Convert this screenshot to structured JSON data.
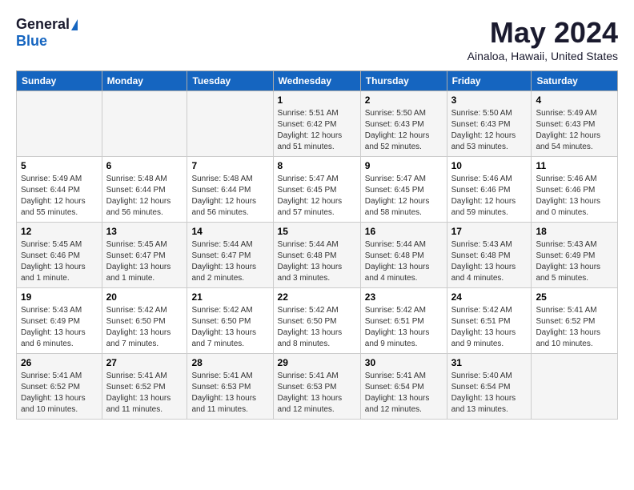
{
  "header": {
    "logo_general": "General",
    "logo_blue": "Blue",
    "month_title": "May 2024",
    "location": "Ainaloa, Hawaii, United States"
  },
  "days_of_week": [
    "Sunday",
    "Monday",
    "Tuesday",
    "Wednesday",
    "Thursday",
    "Friday",
    "Saturday"
  ],
  "weeks": [
    [
      {
        "day": "",
        "info": ""
      },
      {
        "day": "",
        "info": ""
      },
      {
        "day": "",
        "info": ""
      },
      {
        "day": "1",
        "info": "Sunrise: 5:51 AM\nSunset: 6:42 PM\nDaylight: 12 hours\nand 51 minutes."
      },
      {
        "day": "2",
        "info": "Sunrise: 5:50 AM\nSunset: 6:43 PM\nDaylight: 12 hours\nand 52 minutes."
      },
      {
        "day": "3",
        "info": "Sunrise: 5:50 AM\nSunset: 6:43 PM\nDaylight: 12 hours\nand 53 minutes."
      },
      {
        "day": "4",
        "info": "Sunrise: 5:49 AM\nSunset: 6:43 PM\nDaylight: 12 hours\nand 54 minutes."
      }
    ],
    [
      {
        "day": "5",
        "info": "Sunrise: 5:49 AM\nSunset: 6:44 PM\nDaylight: 12 hours\nand 55 minutes."
      },
      {
        "day": "6",
        "info": "Sunrise: 5:48 AM\nSunset: 6:44 PM\nDaylight: 12 hours\nand 56 minutes."
      },
      {
        "day": "7",
        "info": "Sunrise: 5:48 AM\nSunset: 6:44 PM\nDaylight: 12 hours\nand 56 minutes."
      },
      {
        "day": "8",
        "info": "Sunrise: 5:47 AM\nSunset: 6:45 PM\nDaylight: 12 hours\nand 57 minutes."
      },
      {
        "day": "9",
        "info": "Sunrise: 5:47 AM\nSunset: 6:45 PM\nDaylight: 12 hours\nand 58 minutes."
      },
      {
        "day": "10",
        "info": "Sunrise: 5:46 AM\nSunset: 6:46 PM\nDaylight: 12 hours\nand 59 minutes."
      },
      {
        "day": "11",
        "info": "Sunrise: 5:46 AM\nSunset: 6:46 PM\nDaylight: 13 hours\nand 0 minutes."
      }
    ],
    [
      {
        "day": "12",
        "info": "Sunrise: 5:45 AM\nSunset: 6:46 PM\nDaylight: 13 hours\nand 1 minute."
      },
      {
        "day": "13",
        "info": "Sunrise: 5:45 AM\nSunset: 6:47 PM\nDaylight: 13 hours\nand 1 minute."
      },
      {
        "day": "14",
        "info": "Sunrise: 5:44 AM\nSunset: 6:47 PM\nDaylight: 13 hours\nand 2 minutes."
      },
      {
        "day": "15",
        "info": "Sunrise: 5:44 AM\nSunset: 6:48 PM\nDaylight: 13 hours\nand 3 minutes."
      },
      {
        "day": "16",
        "info": "Sunrise: 5:44 AM\nSunset: 6:48 PM\nDaylight: 13 hours\nand 4 minutes."
      },
      {
        "day": "17",
        "info": "Sunrise: 5:43 AM\nSunset: 6:48 PM\nDaylight: 13 hours\nand 4 minutes."
      },
      {
        "day": "18",
        "info": "Sunrise: 5:43 AM\nSunset: 6:49 PM\nDaylight: 13 hours\nand 5 minutes."
      }
    ],
    [
      {
        "day": "19",
        "info": "Sunrise: 5:43 AM\nSunset: 6:49 PM\nDaylight: 13 hours\nand 6 minutes."
      },
      {
        "day": "20",
        "info": "Sunrise: 5:42 AM\nSunset: 6:50 PM\nDaylight: 13 hours\nand 7 minutes."
      },
      {
        "day": "21",
        "info": "Sunrise: 5:42 AM\nSunset: 6:50 PM\nDaylight: 13 hours\nand 7 minutes."
      },
      {
        "day": "22",
        "info": "Sunrise: 5:42 AM\nSunset: 6:50 PM\nDaylight: 13 hours\nand 8 minutes."
      },
      {
        "day": "23",
        "info": "Sunrise: 5:42 AM\nSunset: 6:51 PM\nDaylight: 13 hours\nand 9 minutes."
      },
      {
        "day": "24",
        "info": "Sunrise: 5:42 AM\nSunset: 6:51 PM\nDaylight: 13 hours\nand 9 minutes."
      },
      {
        "day": "25",
        "info": "Sunrise: 5:41 AM\nSunset: 6:52 PM\nDaylight: 13 hours\nand 10 minutes."
      }
    ],
    [
      {
        "day": "26",
        "info": "Sunrise: 5:41 AM\nSunset: 6:52 PM\nDaylight: 13 hours\nand 10 minutes."
      },
      {
        "day": "27",
        "info": "Sunrise: 5:41 AM\nSunset: 6:52 PM\nDaylight: 13 hours\nand 11 minutes."
      },
      {
        "day": "28",
        "info": "Sunrise: 5:41 AM\nSunset: 6:53 PM\nDaylight: 13 hours\nand 11 minutes."
      },
      {
        "day": "29",
        "info": "Sunrise: 5:41 AM\nSunset: 6:53 PM\nDaylight: 13 hours\nand 12 minutes."
      },
      {
        "day": "30",
        "info": "Sunrise: 5:41 AM\nSunset: 6:54 PM\nDaylight: 13 hours\nand 12 minutes."
      },
      {
        "day": "31",
        "info": "Sunrise: 5:40 AM\nSunset: 6:54 PM\nDaylight: 13 hours\nand 13 minutes."
      },
      {
        "day": "",
        "info": ""
      }
    ]
  ]
}
